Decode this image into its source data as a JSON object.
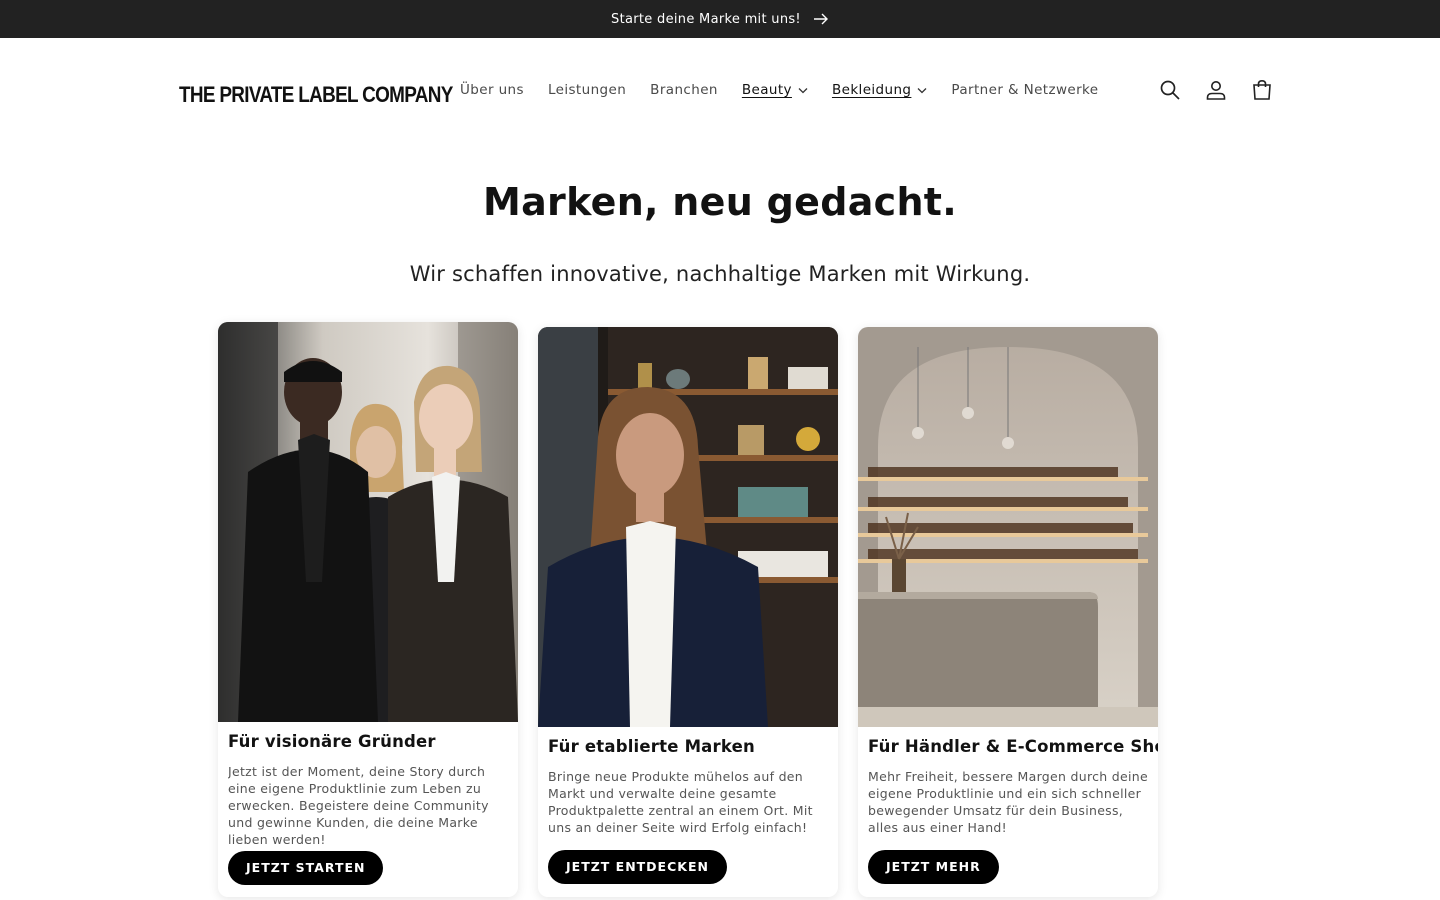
{
  "announcement": {
    "text": "Starte deine Marke mit uns!",
    "icon": "arrow-right-icon"
  },
  "header": {
    "logo": "THE PRIVATE LABEL COMPANY",
    "nav": [
      {
        "label": "Über uns"
      },
      {
        "label": "Leistungen"
      },
      {
        "label": "Branchen"
      },
      {
        "label": "Beauty",
        "dropdown": true,
        "active": true
      },
      {
        "label": "Bekleidung",
        "dropdown": true,
        "active": true
      },
      {
        "label": "Partner & Netzwerke"
      }
    ],
    "icons": [
      "search-icon",
      "account-icon",
      "cart-icon"
    ]
  },
  "hero": {
    "title": "Marken, neu gedacht.",
    "subtitle": "Wir schaffen innovative, nachhaltige Marken mit Wirkung."
  },
  "cards": [
    {
      "title": "Für visionäre Gründer",
      "text": "Jetzt ist der Moment, deine Story durch eine eigene Produktlinie zum Leben zu erwecken. Begeistere deine Community und gewinne Kunden, die deine Marke lieben werden!",
      "button": "JETZT STARTEN",
      "image": "photo-three-young-people-in-suits"
    },
    {
      "title": "Für etablierte Marken",
      "text": "Bringe neue Produkte mühelos auf den Markt und verwalte deine gesamte Produktpalette zentral an einem Ort. Mit uns an deiner Seite wird Erfolg einfach!",
      "button": "JETZT ENTDECKEN",
      "image": "photo-woman-in-boutique"
    },
    {
      "title": "Für Händler & E-Commerce Shops",
      "text": "Mehr Freiheit, bessere Margen durch deine eigene Produktlinie und ein sich schneller bewegender Umsatz für dein Business, alles aus einer Hand!",
      "button": "JETZT MEHR",
      "image": "photo-store-interior-shelves"
    }
  ],
  "colors": {
    "announcement_bg": "#222222",
    "button_bg": "#000000",
    "text": "#121212"
  }
}
